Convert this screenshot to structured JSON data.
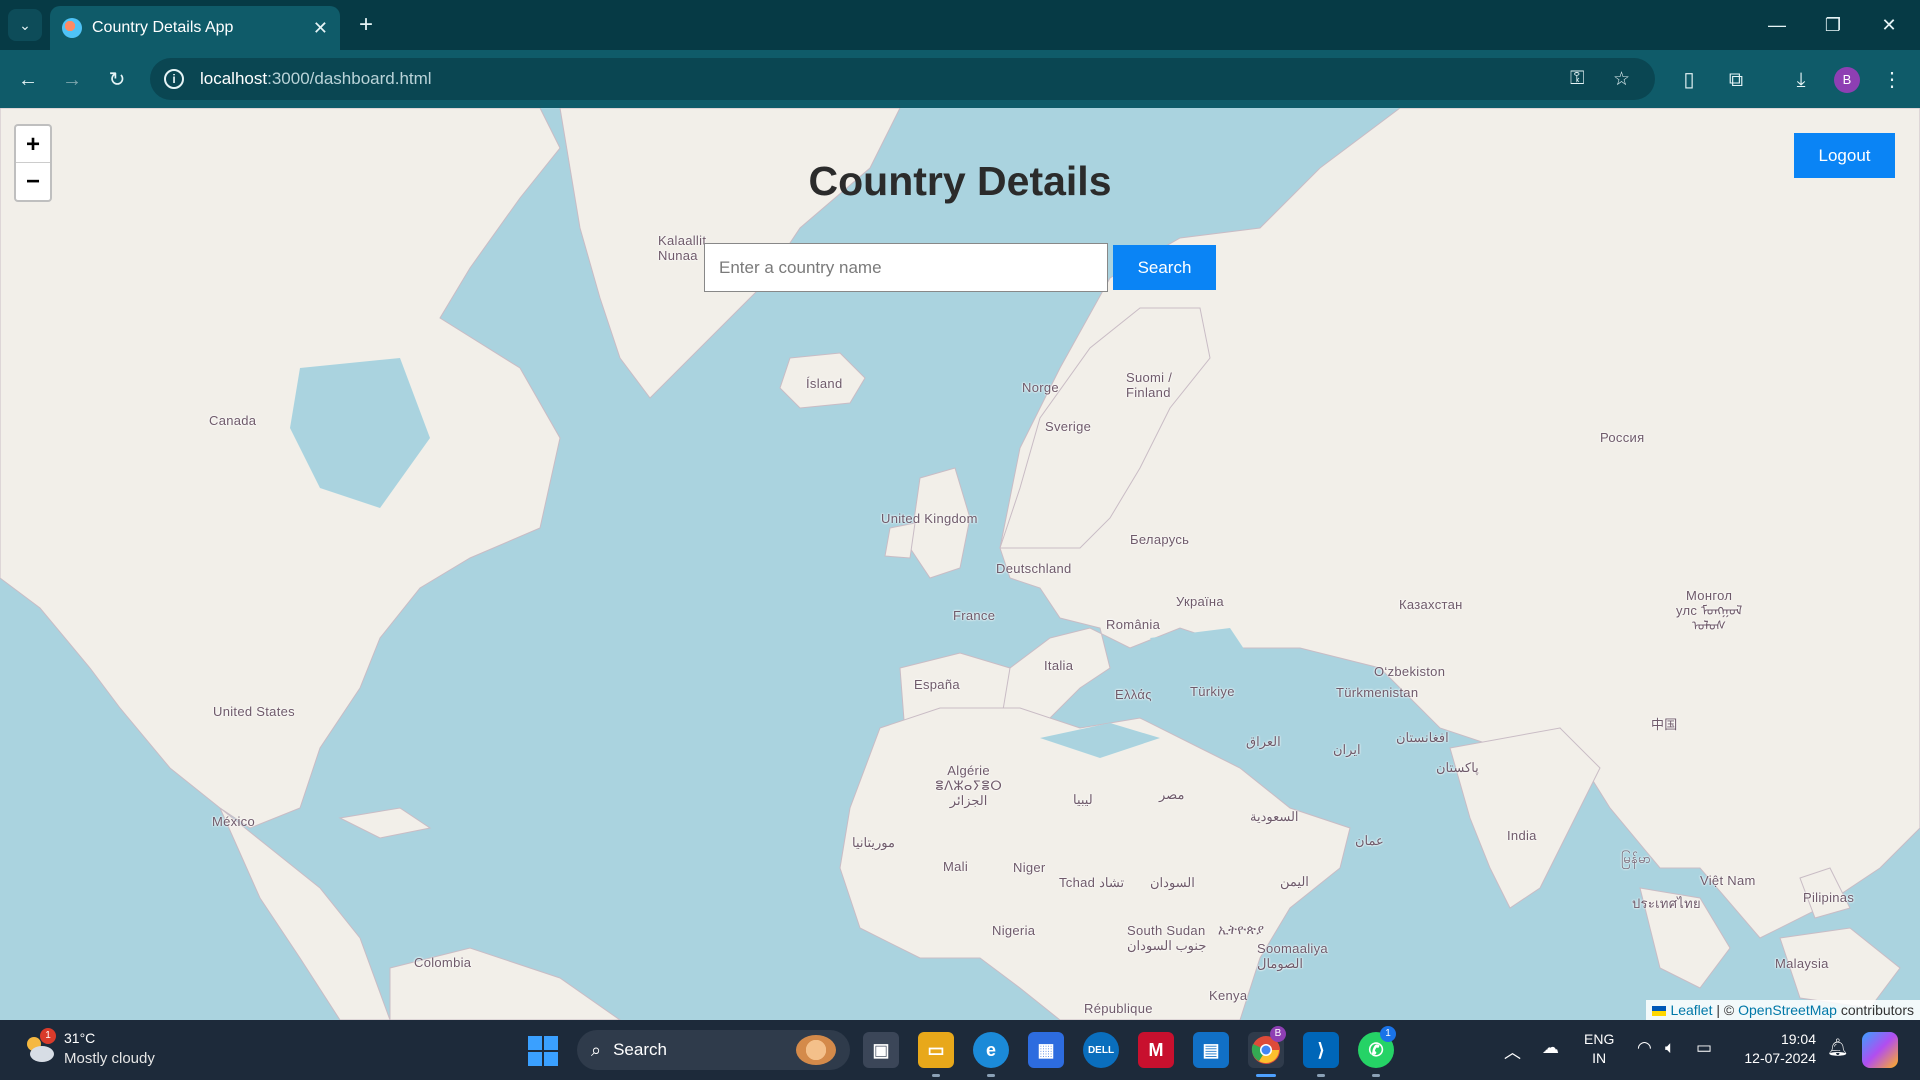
{
  "browser": {
    "tab_title": "Country Details App",
    "url_host": "localhost",
    "url_path": ":3000/dashboard.html",
    "profile_initial": "B"
  },
  "page": {
    "title": "Country Details",
    "search_placeholder": "Enter a country name",
    "search_button": "Search",
    "logout_button": "Logout",
    "zoom_in": "+",
    "zoom_out": "−"
  },
  "map": {
    "labels": {
      "kalaallit": "Kalaallit\nNunaa",
      "island": "Ísland",
      "norge": "Norge",
      "suomi": "Suomi /\nFinland",
      "sverige": "Sverige",
      "russia": "Россия",
      "canada": "Canada",
      "uk": "United Kingdom",
      "belarus": "Беларусь",
      "deutschland": "Deutschland",
      "ukraina": "Україна",
      "france": "France",
      "romania": "România",
      "kazakhstan": "Казахстан",
      "mongolia": "Монгол\nулс ᠮᠤᠩᠭᠤᠯ\nᠤᠯᠤᠰ",
      "italia": "Italia",
      "uzbekistan": "O‘zbekiston",
      "espana": "España",
      "ellas": "Ελλάς",
      "turkiye": "Türkiye",
      "turkmenistan": "Türkmenistan",
      "usa": "United States",
      "iraq": "العراق",
      "afghanistan": "افغانستان",
      "iran": "ایران",
      "pakistan": "پاکستان",
      "china": "中国",
      "algerie": "Algérie\nⴻⴷⵣⴰⵢⴻⵔ\nالجزائر",
      "libya": "ليبيا",
      "egypt": "مصر",
      "mexico": "México",
      "saudi": "السعودية",
      "mauritania": "موريتانيا",
      "oman": "عمان",
      "india": "India",
      "mali": "Mali",
      "niger": "Niger",
      "myanmar": "မြန်မာ",
      "tchad": "Tchad تشاد",
      "sudan": "السودان",
      "yemen": "اليمن",
      "vietnam": "Việt Nam",
      "thailand": "ประเทศไทย",
      "pilipinas": "Pilipinas",
      "nigeria": "Nigeria",
      "south_sudan": "South Sudan\nجنوب السودان",
      "ethiopia": "ኢትዮጵያ",
      "somalia": "Soomaaliya\nالصومال",
      "colombia": "Colombia",
      "kenya": "Kenya",
      "republique": "République",
      "malaysia": "Malaysia"
    },
    "attribution": {
      "leaflet": "Leaflet",
      "separator": " | © ",
      "osm": "OpenStreetMap",
      "contributors": " contributors"
    }
  },
  "taskbar": {
    "weather_badge": "1",
    "temperature": "31°C",
    "weather_desc": "Mostly cloudy",
    "search_label": "Search",
    "chrome_badge": "B",
    "whatsapp_badge": "1",
    "lang_top": "ENG",
    "lang_bottom": "IN",
    "time": "19:04",
    "date": "12-07-2024"
  },
  "colors": {
    "water": "#aad3df",
    "land": "#f2efe9",
    "button": "#0a84f5",
    "chrome_dark": "#063a45",
    "chrome_toolbar": "#0f5b69"
  }
}
